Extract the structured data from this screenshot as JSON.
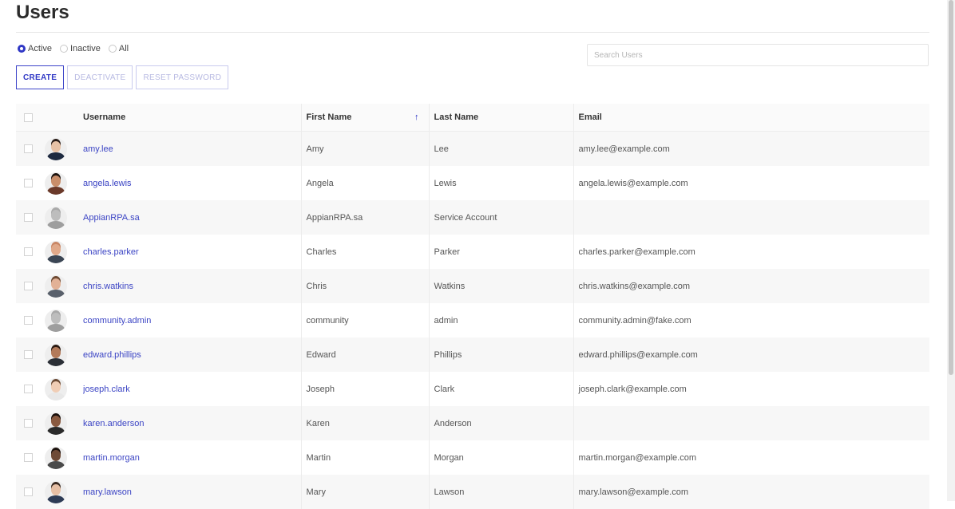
{
  "page": {
    "title": "Users"
  },
  "filters": [
    {
      "label": "Active",
      "checked": true
    },
    {
      "label": "Inactive",
      "checked": false
    },
    {
      "label": "All",
      "checked": false
    }
  ],
  "toolbar": {
    "create_label": "CREATE",
    "deactivate_label": "DEACTIVATE",
    "reset_password_label": "RESET PASSWORD"
  },
  "search": {
    "placeholder": "Search Users",
    "value": ""
  },
  "table": {
    "columns": {
      "username": "Username",
      "first_name": "First Name",
      "last_name": "Last Name",
      "email": "Email"
    },
    "sort": {
      "column": "last_name",
      "direction": "ascending",
      "icon": "arrow-up-icon"
    },
    "rows": [
      {
        "username": "amy.lee",
        "first_name": "Amy",
        "last_name": "Lee",
        "email": "amy.lee@example.com",
        "avatar": {
          "skin": "#e8c2a6",
          "hair": "#2a1d18",
          "shirt": "#1e2a40"
        }
      },
      {
        "username": "angela.lewis",
        "first_name": "Angela",
        "last_name": "Lewis",
        "email": "angela.lewis@example.com",
        "avatar": {
          "skin": "#c98e6a",
          "hair": "#1d1410",
          "shirt": "#6b3a2a"
        }
      },
      {
        "username": "AppianRPA.sa",
        "first_name": "AppianRPA.sa",
        "last_name": "Service Account",
        "email": "",
        "avatar": {
          "skin": "#bdbdbd",
          "hair": "#a9a9a9",
          "shirt": "#9e9e9e"
        }
      },
      {
        "username": "charles.parker",
        "first_name": "Charles",
        "last_name": "Parker",
        "email": "charles.parker@example.com",
        "avatar": {
          "skin": "#e0a98a",
          "hair": "#c98766",
          "shirt": "#3b4654"
        }
      },
      {
        "username": "chris.watkins",
        "first_name": "Chris",
        "last_name": "Watkins",
        "email": "chris.watkins@example.com",
        "avatar": {
          "skin": "#e2b196",
          "hair": "#6e4a33",
          "shirt": "#59606b"
        }
      },
      {
        "username": "community.admin",
        "first_name": "community",
        "last_name": "admin",
        "email": "community.admin@fake.com",
        "avatar": {
          "skin": "#bdbdbd",
          "hair": "#a9a9a9",
          "shirt": "#9e9e9e"
        }
      },
      {
        "username": "edward.phillips",
        "first_name": "Edward",
        "last_name": "Phillips",
        "email": "edward.phillips@example.com",
        "avatar": {
          "skin": "#b37a5a",
          "hair": "#2a1a12",
          "shirt": "#2b2f36"
        }
      },
      {
        "username": "joseph.clark",
        "first_name": "Joseph",
        "last_name": "Clark",
        "email": "joseph.clark@example.com",
        "avatar": {
          "skin": "#f0cdb5",
          "hair": "#6b4a34",
          "shirt": "#e8e8e8"
        }
      },
      {
        "username": "karen.anderson",
        "first_name": "Karen",
        "last_name": "Anderson",
        "email": "",
        "avatar": {
          "skin": "#8a5a40",
          "hair": "#1a100c",
          "shirt": "#2a2a2a"
        }
      },
      {
        "username": "martin.morgan",
        "first_name": "Martin",
        "last_name": "Morgan",
        "email": "martin.morgan@example.com",
        "avatar": {
          "skin": "#6e4a36",
          "hair": "#1c120d",
          "shirt": "#4a4a4a"
        }
      },
      {
        "username": "mary.lawson",
        "first_name": "Mary",
        "last_name": "Lawson",
        "email": "mary.lawson@example.com",
        "avatar": {
          "skin": "#e6bfa5",
          "hair": "#3a2a22",
          "shirt": "#2d3b55"
        }
      }
    ]
  },
  "colors": {
    "accent": "#2f37c5",
    "link": "#3b44c4"
  }
}
